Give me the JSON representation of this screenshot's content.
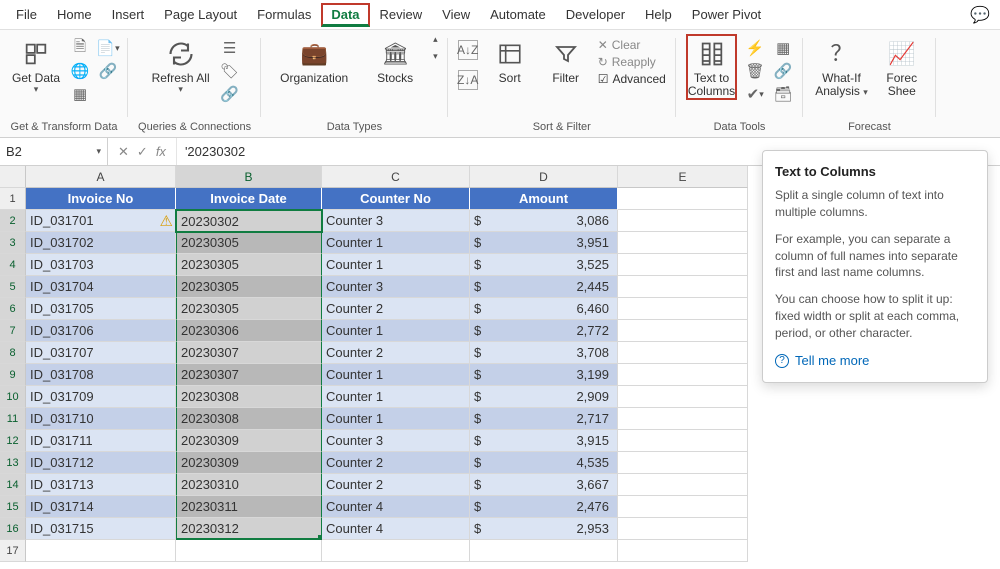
{
  "tabs": [
    "File",
    "Home",
    "Insert",
    "Page Layout",
    "Formulas",
    "Data",
    "Review",
    "View",
    "Automate",
    "Developer",
    "Help",
    "Power Pivot"
  ],
  "activeTab": "Data",
  "ribbon": {
    "getData": "Get Data",
    "refreshAll": "Refresh All",
    "groupGetTransform": "Get & Transform Data",
    "groupQueries": "Queries & Connections",
    "organization": "Organization",
    "stocks": "Stocks",
    "groupDataTypes": "Data Types",
    "sort": "Sort",
    "filter": "Filter",
    "clear": "Clear",
    "reapply": "Reapply",
    "advanced": "Advanced",
    "groupSortFilter": "Sort & Filter",
    "textToColumns_l1": "Text to",
    "textToColumns_l2": "Columns",
    "groupDataTools": "Data Tools",
    "whatIf_l1": "What-If",
    "whatIf_l2": "Analysis",
    "forecast_l1": "Forec",
    "forecast_l2": "Shee",
    "groupForecast": "Forecast"
  },
  "formulaBar": {
    "nameBox": "B2",
    "formula": "'20230302"
  },
  "columns": [
    "A",
    "B",
    "C",
    "D",
    "E"
  ],
  "rowNums": [
    "1",
    "2",
    "3",
    "4",
    "5",
    "6",
    "7",
    "8",
    "9",
    "10",
    "11",
    "12",
    "13",
    "14",
    "15",
    "16",
    "17"
  ],
  "headers": {
    "A": "Invoice No",
    "B": "Invoice Date",
    "C": "Counter No",
    "D": "Amount"
  },
  "rows": [
    {
      "a": "ID_031701",
      "b": "20230302",
      "c": "Counter 3",
      "d": "3,086"
    },
    {
      "a": "ID_031702",
      "b": "20230305",
      "c": "Counter 1",
      "d": "3,951"
    },
    {
      "a": "ID_031703",
      "b": "20230305",
      "c": "Counter 1",
      "d": "3,525"
    },
    {
      "a": "ID_031704",
      "b": "20230305",
      "c": "Counter 3",
      "d": "2,445"
    },
    {
      "a": "ID_031705",
      "b": "20230305",
      "c": "Counter 2",
      "d": "6,460"
    },
    {
      "a": "ID_031706",
      "b": "20230306",
      "c": "Counter 1",
      "d": "2,772"
    },
    {
      "a": "ID_031707",
      "b": "20230307",
      "c": "Counter 2",
      "d": "3,708"
    },
    {
      "a": "ID_031708",
      "b": "20230307",
      "c": "Counter 1",
      "d": "3,199"
    },
    {
      "a": "ID_031709",
      "b": "20230308",
      "c": "Counter 1",
      "d": "2,909"
    },
    {
      "a": "ID_031710",
      "b": "20230308",
      "c": "Counter 1",
      "d": "2,717"
    },
    {
      "a": "ID_031711",
      "b": "20230309",
      "c": "Counter 3",
      "d": "3,915"
    },
    {
      "a": "ID_031712",
      "b": "20230309",
      "c": "Counter 2",
      "d": "4,535"
    },
    {
      "a": "ID_031713",
      "b": "20230310",
      "c": "Counter 2",
      "d": "3,667"
    },
    {
      "a": "ID_031714",
      "b": "20230311",
      "c": "Counter 4",
      "d": "2,476"
    },
    {
      "a": "ID_031715",
      "b": "20230312",
      "c": "Counter 4",
      "d": "2,953"
    }
  ],
  "tooltip": {
    "title": "Text to Columns",
    "p1": "Split a single column of text into multiple columns.",
    "p2": "For example, you can separate a column of full names into separate first and last name columns.",
    "p3": "You can choose how to split it up: fixed width or split at each comma, period, or other character.",
    "link": "Tell me more"
  }
}
